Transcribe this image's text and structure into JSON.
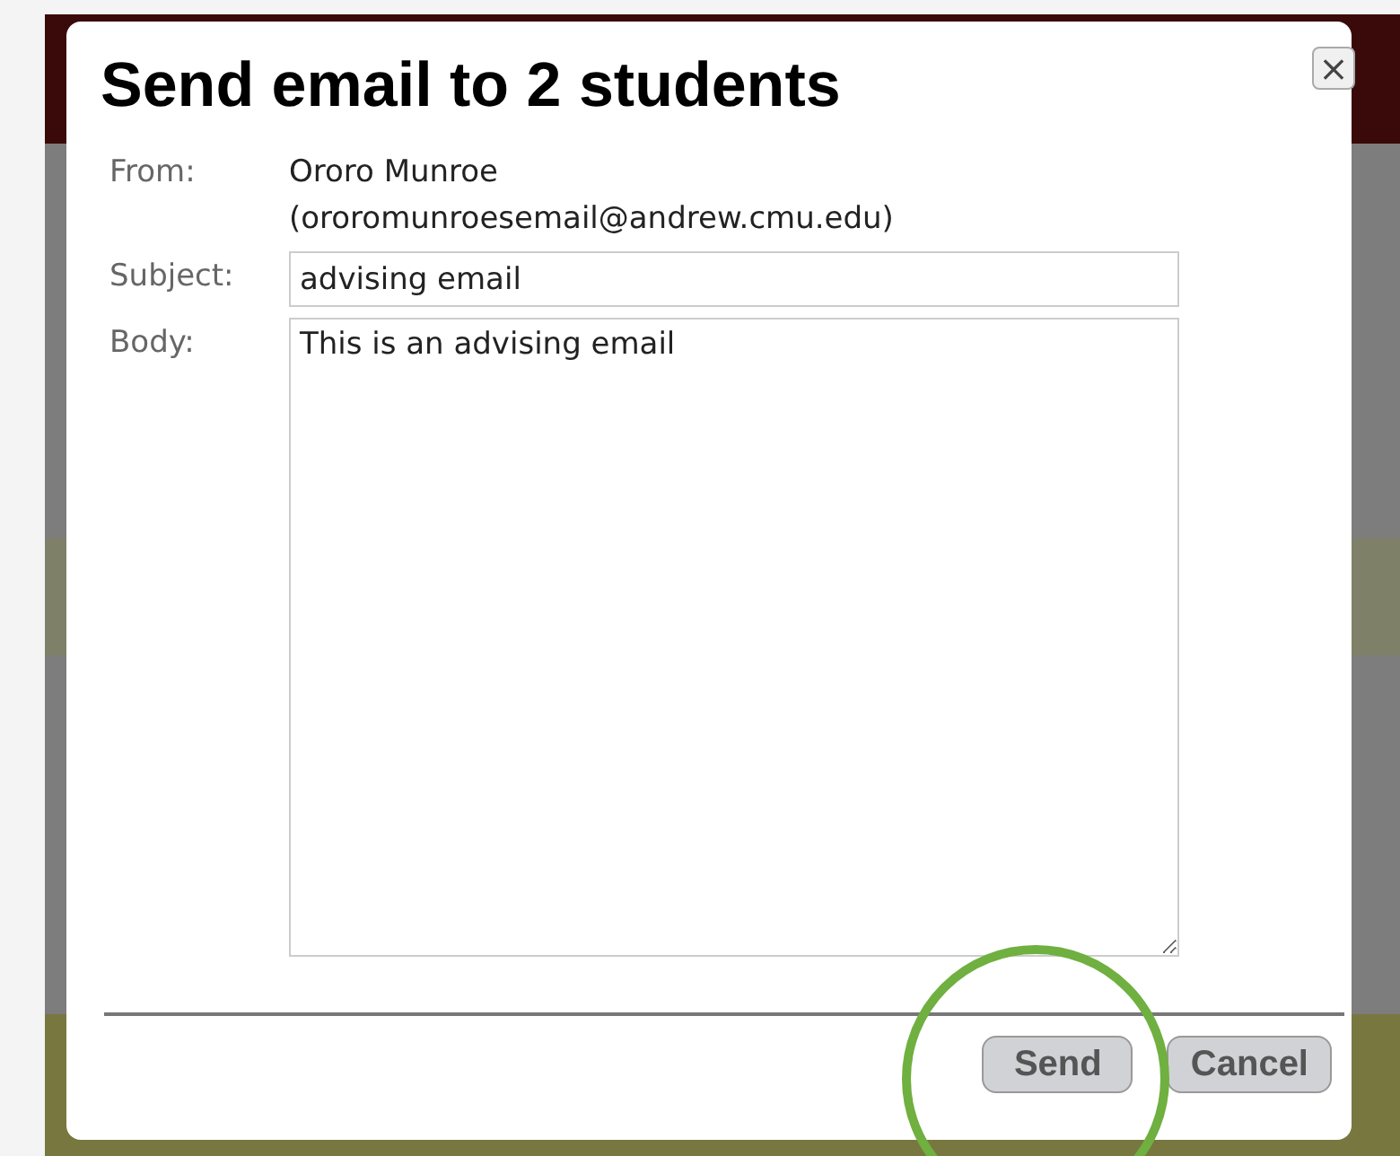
{
  "dialog": {
    "title": "Send email to 2 students",
    "close": "×"
  },
  "fields": [
    {
      "kind": "text",
      "label": "From:",
      "lines": [
        "Ororo Munroe",
        "(ororomunroesemail@andrew.cmu.edu)"
      ]
    },
    {
      "kind": "input",
      "label": "Subject:",
      "value": "advising email"
    },
    {
      "kind": "textarea",
      "label": "Body:",
      "value": "This is an advising email"
    }
  ],
  "buttons": [
    "Send",
    "Cancel"
  ]
}
